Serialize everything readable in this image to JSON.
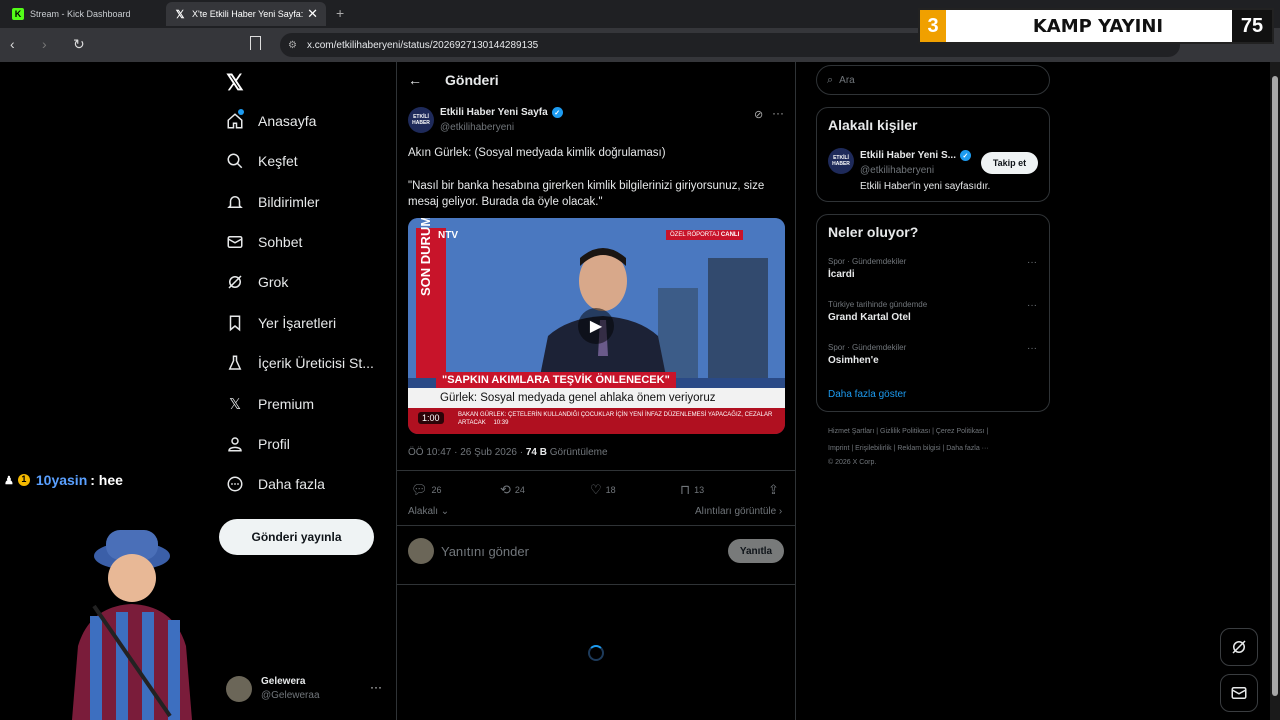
{
  "browser": {
    "tabs": [
      {
        "label": "Stream - Kick Dashboard",
        "icon": "kick-icon"
      },
      {
        "label": "X'te Etkili Haber Yeni Sayfa: \"A",
        "icon": "x-logo-icon"
      }
    ],
    "new_tab": "+",
    "url": "x.com/etkilihaberyeni/status/2026927130144289135"
  },
  "stream_overlay": {
    "left_number": "3",
    "title": "KAMP YAYINI",
    "right_number": "75"
  },
  "chat": {
    "username": "10yasin",
    "message": ": hee"
  },
  "sidebar": {
    "logo": "𝕏",
    "items": [
      {
        "label": "Anasayfa",
        "icon": "home-icon"
      },
      {
        "label": "Keşfet",
        "icon": "search-icon"
      },
      {
        "label": "Bildirimler",
        "icon": "bell-icon"
      },
      {
        "label": "Sohbet",
        "icon": "mail-icon"
      },
      {
        "label": "Grok",
        "icon": "grok-icon"
      },
      {
        "label": "Yer İşaretleri",
        "icon": "bookmark-icon"
      },
      {
        "label": "İçerik Üreticisi St...",
        "icon": "flask-icon"
      },
      {
        "label": "Premium",
        "icon": "x-logo-icon"
      },
      {
        "label": "Profil",
        "icon": "person-icon"
      },
      {
        "label": "Daha fazla",
        "icon": "more-circle-icon"
      }
    ],
    "post_button": "Gönderi yayınla",
    "account": {
      "name": "Gelewera",
      "handle": "@Geleweraa"
    }
  },
  "header": {
    "title": "Gönderi"
  },
  "post": {
    "author_name": "Etkili Haber Yeni Sayfa",
    "author_handle": "@etkilihaberyeni",
    "avatar_text": "ETKİLİ HABER",
    "text_line1": "Akın Gürlek: (Sosyal medyada kimlik doğrulaması)",
    "text_line2": "\"Nasıl bir banka hesabına girerken kimlik bilgilerinizi giriyorsunuz, size mesaj geliyor. Burada da öyle olacak.\"",
    "video": {
      "duration": "1:00",
      "channel": "NTV",
      "side_band": "SON DURUM",
      "tag1": "ÖZEL RÖPORTAJ",
      "tag2": "CANLI",
      "headline": "\"SAPKIN AKIMLARA TEŞVİK ÖNLENECEK\"",
      "subline": "Gürlek: Sosyal medyada genel ahlaka önem veriyoruz",
      "ticker": "BAKAN GÜRLEK: ÇETELERİN KULLANDIĞI ÇOCUKLAR İÇİN YENİ İNFAZ DÜZENLEMESİ YAPACAĞIZ, CEZALAR ARTACAK",
      "ticker_time": "10:39"
    },
    "timestamp": "ÖÖ 10:47 · 26 Şub 2026 · ",
    "views_count": "74 B",
    "views_label": " Görüntüleme",
    "actions": {
      "replies": "26",
      "reposts": "24",
      "likes": "18",
      "bookmarks": "13"
    },
    "related_label": "Alakalı",
    "quotes_label": "Alıntıları görüntüle ›"
  },
  "reply": {
    "placeholder": "Yanıtını gönder",
    "button": "Yanıtla"
  },
  "right": {
    "search_placeholder": "Ara",
    "related_title": "Alakalı kişiler",
    "related_person": {
      "name": "Etkili Haber Yeni S...",
      "handle": "@etkilihaberyeni",
      "bio": "Etkili Haber'in yeni sayfasıdır.",
      "follow": "Takip et"
    },
    "trends_title": "Neler oluyor?",
    "trends": [
      {
        "category": "Spor · Gündemdekiler",
        "name": "İcardi"
      },
      {
        "category": "Türkiye tarihinde gündemde",
        "name": "Grand Kartal Otel"
      },
      {
        "category": "Spor · Gündemdekiler",
        "name": "Osimhen'e"
      }
    ],
    "show_more": "Daha fazla göster",
    "footer_line1": "Hizmet Şartları  |  Gizlilik Politikası  |  Çerez Politikası  |",
    "footer_line2": "Imprint  |  Erişilebilirlik  |  Reklam bilgisi  |  Daha fazla ···",
    "footer_line3": "© 2026 X Corp."
  }
}
